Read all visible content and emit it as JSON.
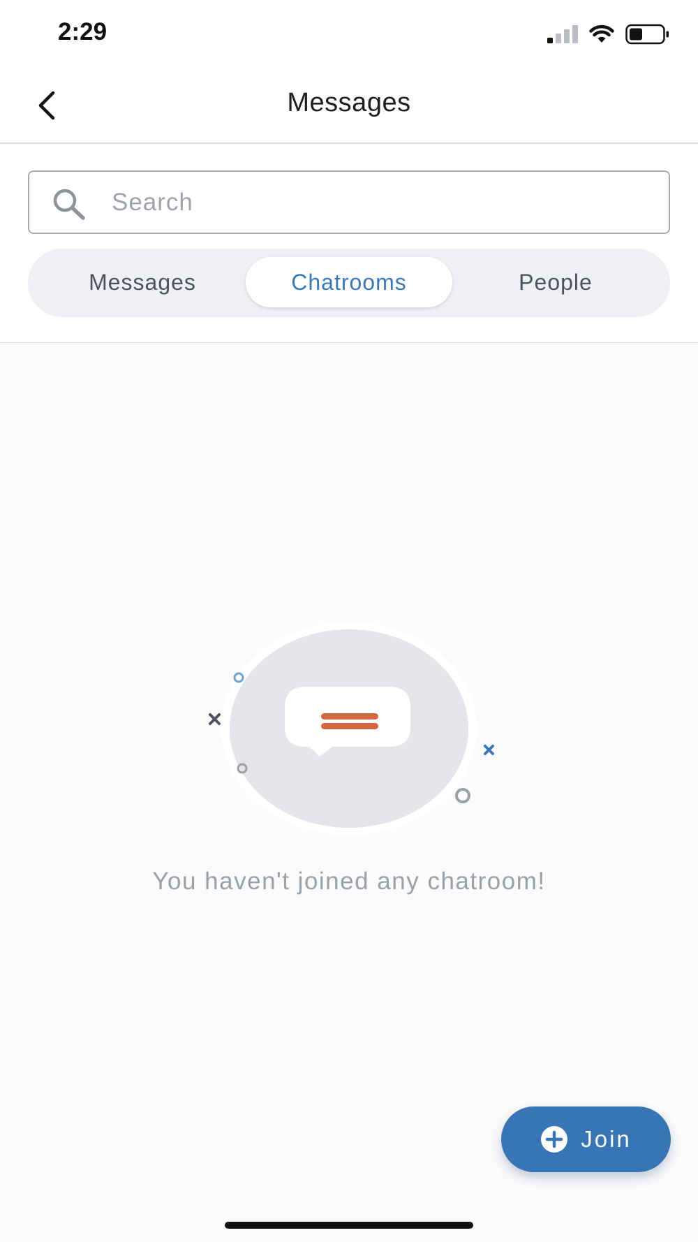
{
  "status_bar": {
    "time": "2:29",
    "icons": [
      "cellular-signal-icon",
      "wifi-icon",
      "battery-icon"
    ]
  },
  "header": {
    "back_icon": "chevron-left-icon",
    "title": "Messages"
  },
  "search": {
    "placeholder": "Search",
    "value": "",
    "icon": "search-icon"
  },
  "tabs": [
    {
      "label": "Messages",
      "active": false
    },
    {
      "label": "Chatrooms",
      "active": true
    },
    {
      "label": "People",
      "active": false
    }
  ],
  "empty_state": {
    "icon": "chat-bubble-icon",
    "message": "You haven't joined any chatroom!"
  },
  "join_button": {
    "label": "Join",
    "icon": "plus-circle-icon"
  },
  "colors": {
    "accent": "#3775b6",
    "empty_icon_accent": "#d4673f",
    "muted_text": "#9aa0aa"
  }
}
